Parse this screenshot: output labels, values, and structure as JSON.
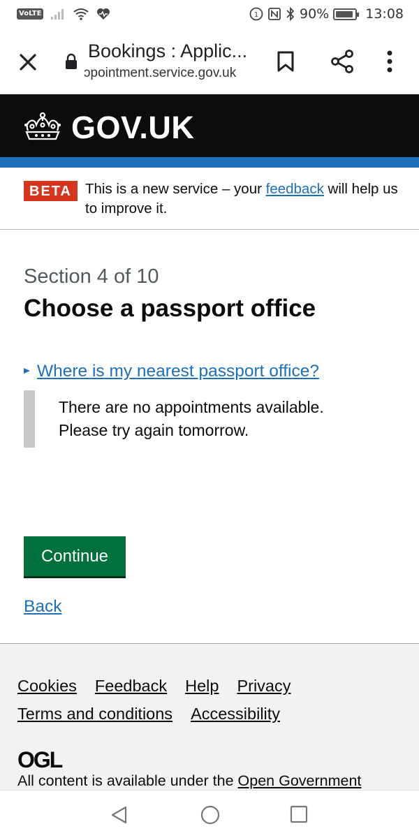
{
  "status_bar": {
    "network_badge": "VoLTE",
    "battery_text": "90%",
    "battery_level": 0.9,
    "time": "13:08",
    "icons": [
      "signal-icon",
      "wifi-icon",
      "health-icon",
      "nfc-icon",
      "bluetooth-icon",
      "battery-icon"
    ]
  },
  "browser": {
    "page_title": "Bookings : Applic...",
    "url": "ɔpointment.service.gov.uk",
    "icons": [
      "close-icon",
      "lock-icon",
      "bookmark-icon",
      "share-icon",
      "more-icon"
    ]
  },
  "header": {
    "brand": "GOV.UK",
    "accent_color": "#1d70b8"
  },
  "beta_banner": {
    "tag": "BETA",
    "text_before": "This is a new service – your ",
    "link": "feedback",
    "text_after": " will help us to improve it."
  },
  "main": {
    "caption": "Section 4 of 10",
    "heading": "Choose a passport office",
    "details_summary": "Where is my nearest passport office?",
    "details_line1": "There are no appointments available.",
    "details_line2": "Please try again tomorrow.",
    "continue_label": "Continue",
    "back_label": "Back",
    "button_color": "#00703c"
  },
  "footer": {
    "links": [
      "Cookies",
      "Feedback",
      "Help",
      "Privacy",
      "Terms and conditions",
      "Accessibility"
    ],
    "ogl": "OGL",
    "licence_before": "All content is available under the ",
    "licence_link": "Open Government"
  },
  "nav_bar": {
    "icons": [
      "back-triangle-icon",
      "home-circle-icon",
      "recents-square-icon"
    ]
  }
}
